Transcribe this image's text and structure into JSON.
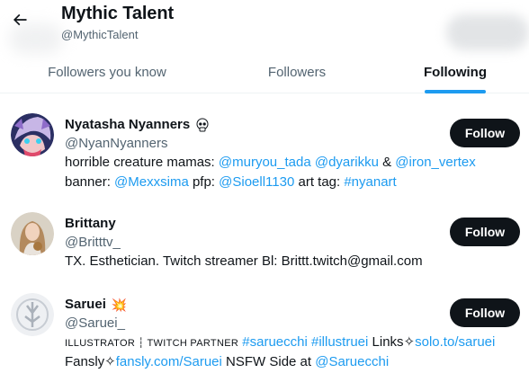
{
  "header": {
    "title": "Mythic Talent",
    "handle": "@MythicTalent",
    "back_icon": "arrow-left-icon"
  },
  "tabs": [
    {
      "label": "Followers you know",
      "active": false
    },
    {
      "label": "Followers",
      "active": false
    },
    {
      "label": "Following",
      "active": true
    }
  ],
  "colors": {
    "accent": "#1d9bf0",
    "text": "#0f1419",
    "muted": "#536471",
    "button": "#0f1419"
  },
  "users": [
    {
      "name": "Nyatasha Nyanners",
      "badge_icon": "skull-icon",
      "handle": "@NyanNyanners",
      "follow_label": "Follow",
      "bio_line1": [
        "horrible creature mamas: ",
        "@muryou_tada",
        " ",
        "@dyarikku",
        " & ",
        "@iron_vertex"
      ],
      "bio_line2": [
        "banner: ",
        "@Mexxsima",
        " pfp: ",
        "@Sioell1130",
        " art tag: ",
        "#nyanart"
      ]
    },
    {
      "name": "Brittany",
      "handle": "@Britttv_",
      "follow_label": "Follow",
      "bio_line1": [
        "TX. Esthetician. Twitch streamer Bl: Brittt.twitch@gmail.com"
      ]
    },
    {
      "name": "Saruei",
      "badge_icon": "collision-icon",
      "badge_glyph": "💥",
      "handle": "@Saruei_",
      "follow_label": "Follow",
      "bio_line1": [
        "ILLUSTRATOR ┆ TWITCH PARTNER",
        " ",
        "#saruecchi",
        " ",
        "#illustruei",
        " Links✧",
        "solo.to/saruei"
      ],
      "bio_line2": [
        "Fansly✧",
        "fansly.com/Saruei",
        " NSFW Side at ",
        "@Saruecchi"
      ]
    }
  ]
}
